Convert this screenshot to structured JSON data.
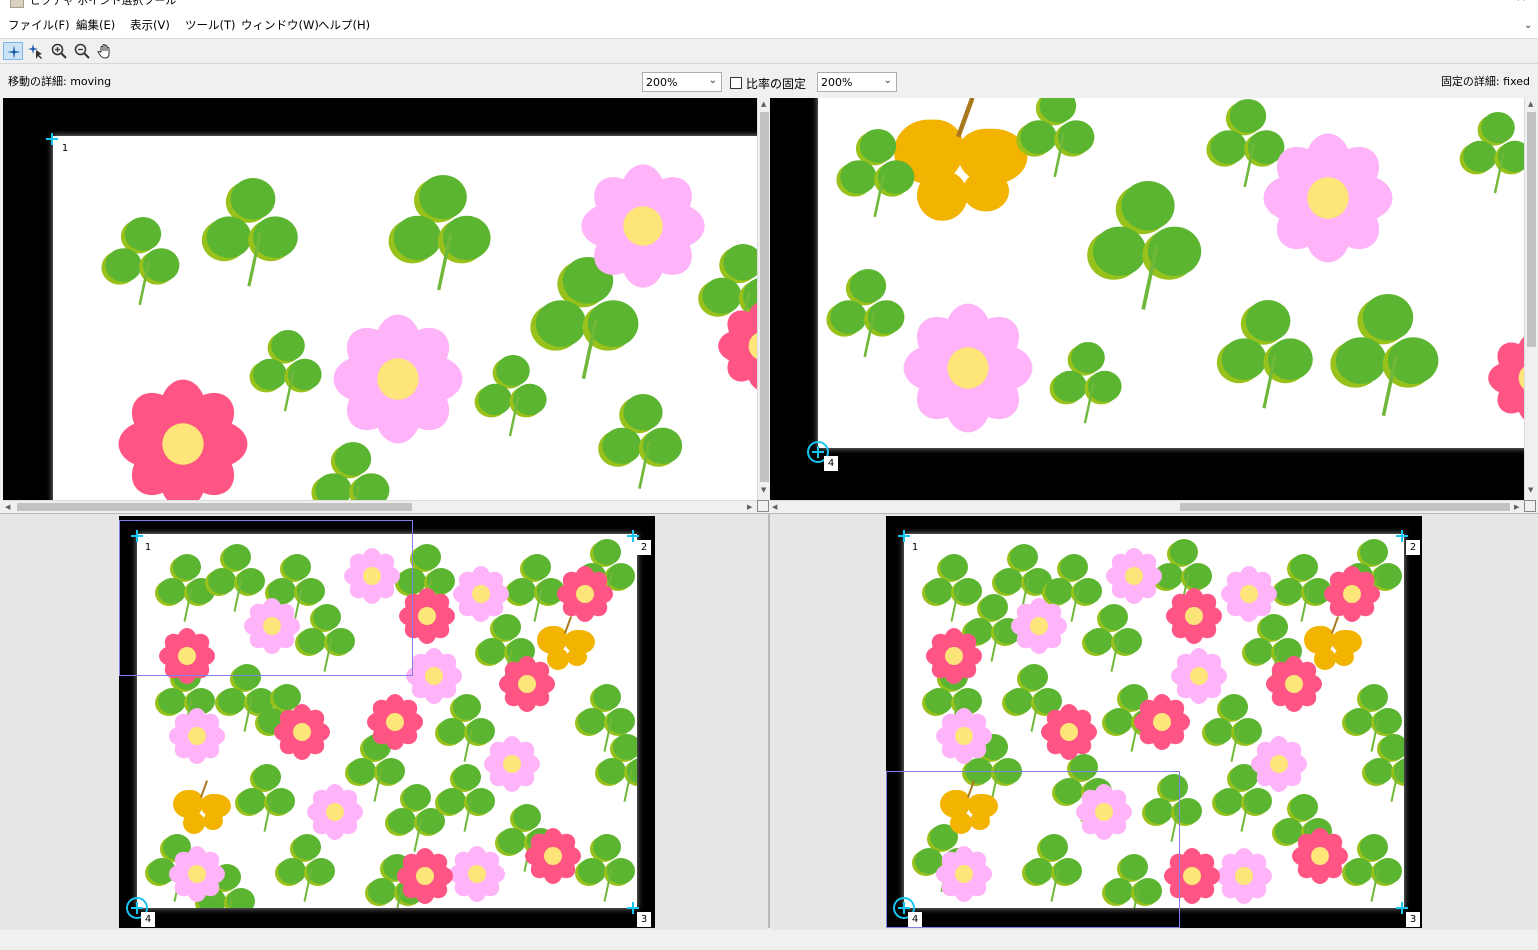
{
  "window": {
    "title": "ピクチャ ポイント選択ツール"
  },
  "menu": {
    "items": [
      {
        "label": "ファイル(F)"
      },
      {
        "label": "編集(E)"
      },
      {
        "label": "表示(V)"
      },
      {
        "label": "ツール(T)"
      },
      {
        "label": "ウィンドウ(W)"
      },
      {
        "label": "ヘルプ(H)"
      }
    ]
  },
  "toolbar": {
    "tools": [
      {
        "icon": "add-point-icon",
        "active": true
      },
      {
        "icon": "select-points-icon",
        "active": false
      },
      {
        "icon": "zoom-in-icon",
        "active": false
      },
      {
        "icon": "zoom-out-icon",
        "active": false
      },
      {
        "icon": "pan-hand-icon",
        "active": false
      }
    ]
  },
  "options": {
    "moving_label": "移動の詳細: moving",
    "moving_zoom": "200%",
    "lock_ratio_label": "比率の固定",
    "lock_ratio_checked": false,
    "fixed_zoom": "200%",
    "fixed_label": "固定の詳細: fixed"
  },
  "points": {
    "moving_detail": [
      "1"
    ],
    "fixed_detail": [
      "4"
    ],
    "moving_overview": [
      "1",
      "2",
      "3",
      "4"
    ],
    "fixed_overview": [
      "1",
      "2",
      "3",
      "4"
    ]
  },
  "colors": {
    "point_marker": "#19c6f2",
    "selection_rect": "#8080e8",
    "clover_green": "#5cb531",
    "flower_pink": "#ffb3f9",
    "flower_red": "#ff5585",
    "butterfly": "#f2b400"
  }
}
